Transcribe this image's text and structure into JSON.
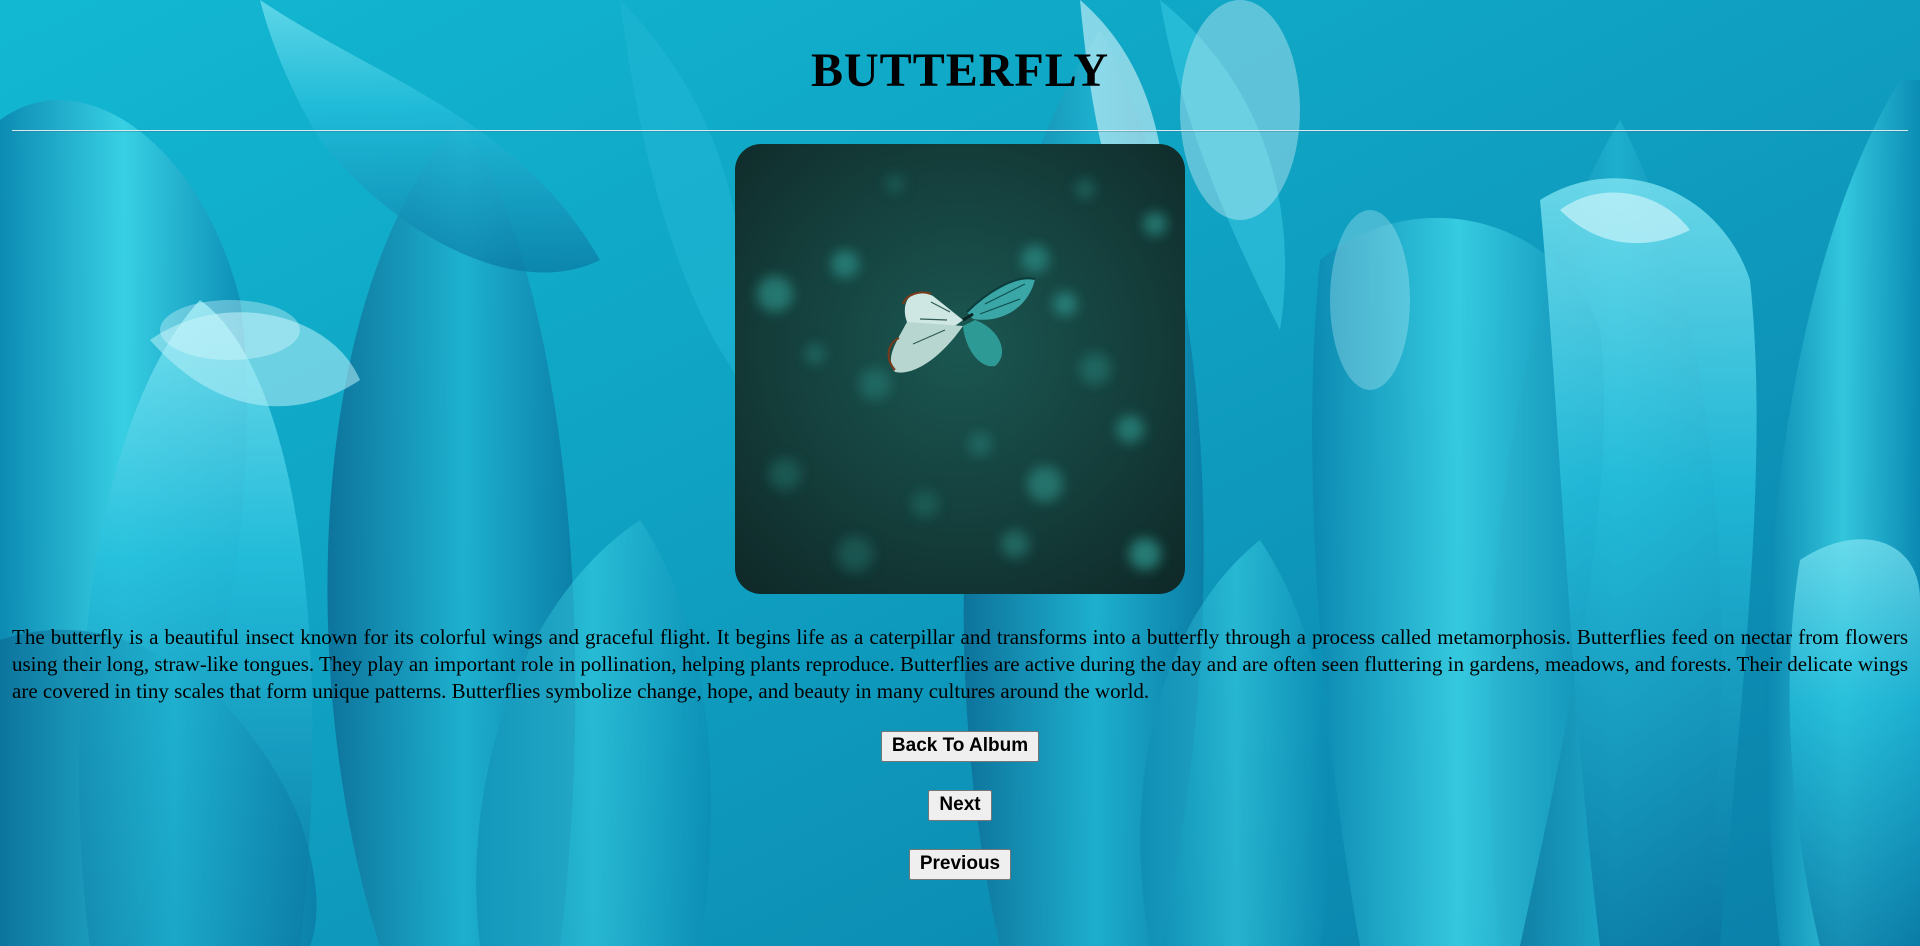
{
  "page": {
    "title": "BUTTERFLY",
    "description": "The butterfly is a beautiful insect known for its colorful wings and graceful flight. It begins life as a caterpillar and transforms into a butterfly through a process called metamorphosis. Butterflies feed on nectar from flowers using their long, straw-like tongues. They play an important role in pollination, helping plants reproduce. Butterflies are active during the day and are often seen fluttering in gardens, meadows, and forests. Their delicate wings are covered in tiny scales that form unique patterns. Butterflies symbolize change, hope, and beauty in many cultures around the world."
  },
  "buttons": {
    "back": "Back To Album",
    "next": "Next",
    "previous": "Previous"
  },
  "theme": {
    "background_color": "#12a7c4",
    "photo_background": "#123432",
    "butterfly_color": "#3aa6a6"
  }
}
